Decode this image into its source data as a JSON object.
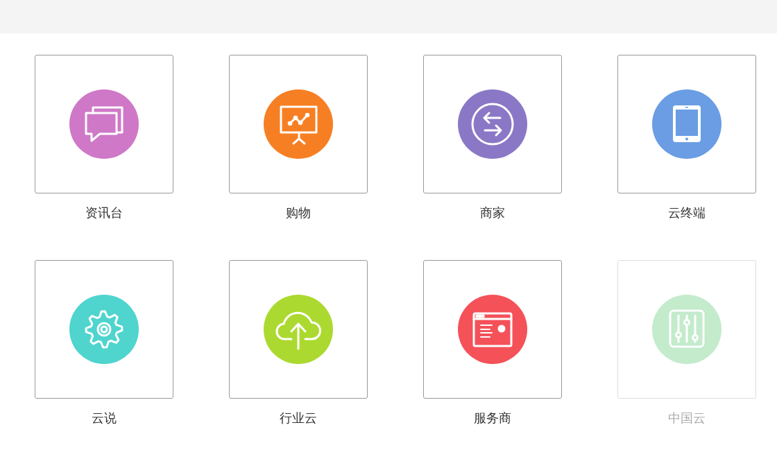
{
  "apps": [
    {
      "label": "资讯台",
      "kind": "chat",
      "color": "#cf78c7",
      "disabled": false
    },
    {
      "label": "购物",
      "kind": "presentation",
      "color": "#f77f23",
      "disabled": false
    },
    {
      "label": "商家",
      "kind": "exchange",
      "color": "#8a78c6",
      "disabled": false
    },
    {
      "label": "云终端",
      "kind": "tablet",
      "color": "#6a9de3",
      "disabled": false
    },
    {
      "label": "云说",
      "kind": "gear",
      "color": "#4fd4ce",
      "disabled": false
    },
    {
      "label": "行业云",
      "kind": "cloud",
      "color": "#acd930",
      "disabled": false
    },
    {
      "label": "服务商",
      "kind": "browser",
      "color": "#f45159",
      "disabled": false
    },
    {
      "label": "中国云",
      "kind": "sliders",
      "color": "#c3ebcc",
      "disabled": true
    }
  ]
}
